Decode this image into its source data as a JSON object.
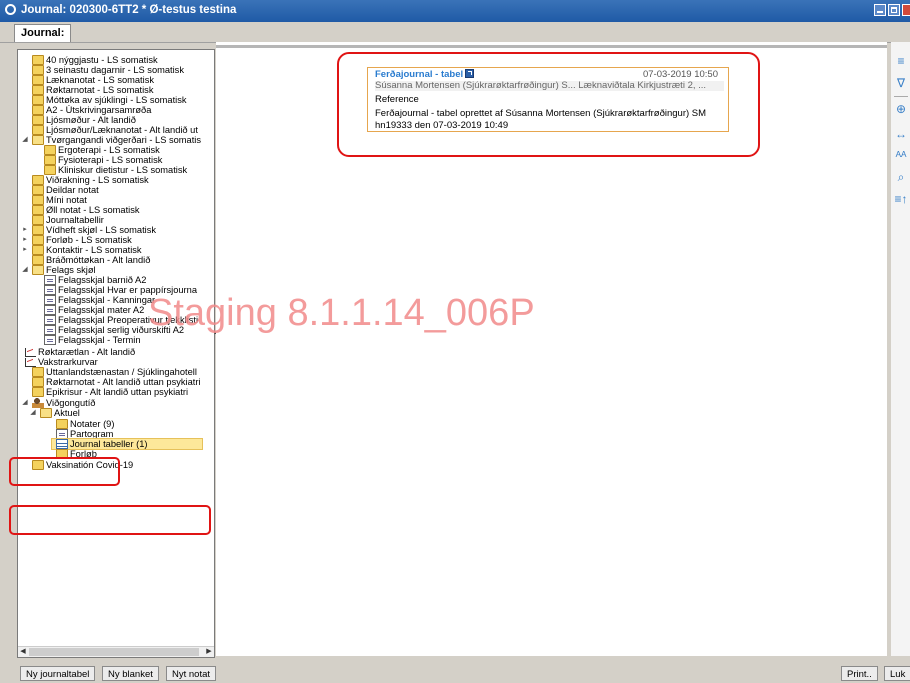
{
  "window": {
    "title": "Journal: 020300-6TT2 * Ø-testus testina"
  },
  "tab": {
    "label": "Journal:"
  },
  "tree": [
    {
      "label": "40 nýggjastu - LS somatisk",
      "icon": "folder-icon"
    },
    {
      "label": "3 seinastu dagarnir - LS somatisk",
      "icon": "folder-icon"
    },
    {
      "label": "Læknanotat - LS somatisk",
      "icon": "folder-icon"
    },
    {
      "label": "Røktarnotat - LS somatisk",
      "icon": "folder-icon"
    },
    {
      "label": "Móttøka av sjúklingi - LS somatisk",
      "icon": "folder-icon"
    },
    {
      "label": "A2 - Útskrivingarsamrøða",
      "icon": "folder-icon"
    },
    {
      "label": "Ljósmøður - Alt landið",
      "icon": "folder-icon"
    },
    {
      "label": "Ljósmøður/Læknanotat - Alt landið ut",
      "icon": "folder-icon"
    },
    {
      "label": "Tvørgangandi viðgerðari - LS somatis",
      "icon": "folder-open-icon",
      "expander": "◢"
    },
    {
      "label": "Ergoterapi - LS somatisk",
      "icon": "folder-icon"
    },
    {
      "label": "Fysioterapi - LS somatisk",
      "icon": "folder-icon"
    },
    {
      "label": "Kliniskur dietistur - LS somatisk",
      "icon": "folder-icon"
    },
    {
      "label": "Viðrakning - LS somatisk",
      "icon": "folder-icon"
    },
    {
      "label": "Deildar notat",
      "icon": "folder-icon"
    },
    {
      "label": "Míni notat",
      "icon": "folder-icon"
    },
    {
      "label": "Øll notat - LS somatisk",
      "icon": "folder-icon"
    },
    {
      "label": "Journaltabellir",
      "icon": "folder-icon"
    },
    {
      "label": "Vídheft skjøl - LS somatisk",
      "icon": "folder-icon",
      "expander": "▸"
    },
    {
      "label": "Forløb - LS somatisk",
      "icon": "folder-icon",
      "expander": "▸"
    },
    {
      "label": "Kontaktir - LS somatisk",
      "icon": "folder-icon",
      "expander": "▸"
    },
    {
      "label": "Bráðmóttøkan - Alt landið",
      "icon": "folder-icon"
    },
    {
      "label": "Felags skjøl",
      "icon": "folder-open-icon",
      "expander": "◢"
    },
    {
      "label": "Felagsskjal barnið A2",
      "icon": "document-icon"
    },
    {
      "label": "Felagsskjal Hvar er pappírsjourna",
      "icon": "document-icon"
    },
    {
      "label": "Felagsskjal - Kanningar",
      "icon": "document-icon"
    },
    {
      "label": "Felagsskjal mater A2",
      "icon": "document-icon"
    },
    {
      "label": "Felagsskjal Preoperativur tjekklisti",
      "icon": "document-icon"
    },
    {
      "label": "Felagsskjal serlig viðurskifti A2",
      "icon": "document-icon"
    },
    {
      "label": "Felagsskjal - Termin",
      "icon": "document-icon"
    },
    {
      "label": "Røktarætlan - Alt landið",
      "icon": "chart-icon"
    },
    {
      "label": "Vakstrarkurvar",
      "icon": "chart-icon"
    },
    {
      "label": "Uttanlandstænastan / Sjúklingahotell",
      "icon": "folder-icon"
    },
    {
      "label": "Røktarnotat - Alt landið uttan psykiatri",
      "icon": "folder-icon"
    },
    {
      "label": "Epikrisur - Alt landið uttan psykiatri",
      "icon": "folder-icon"
    },
    {
      "label": "Viðgongutíð",
      "icon": "person-icon",
      "expander": "◢"
    },
    {
      "label": "Aktuel",
      "icon": "folder-open-icon",
      "expander": "◢"
    },
    {
      "label": "Notater (9)",
      "icon": "folder-icon"
    },
    {
      "label": "Partogram",
      "icon": "document-icon"
    },
    {
      "label": "Journal tabeller (1)",
      "icon": "table-icon",
      "selected": true
    },
    {
      "label": "Forløb",
      "icon": "folder-icon"
    },
    {
      "label": "Vaksinatión Covid-19",
      "icon": "folder-icon"
    }
  ],
  "card": {
    "title": "Ferðajournal - tabel",
    "date": "07-03-2019 10:50",
    "meta": "Súsanna Mortensen (Sjúkrarøktarfrøðingur) S...   Læknaviðtala Kirkjustræti 2, ...",
    "line1": "Reference",
    "line2": "Ferðajournal - tabel    oprettet af Súsanna Mortensen (Sjúkrarøktarfrøðingur) SM",
    "line3": "hn19333 den 07-03-2019 10:49"
  },
  "watermark": "Staging 8.1.1.14_006P",
  "bottom": {
    "btn_new_table": "Ny journaltabel",
    "btn_new_blank": "Ny blanket",
    "btn_new_note": "Nyt notat",
    "btn_print": "Print..",
    "btn_close": "Luk"
  },
  "colors": {
    "titlebar": "#1f5aa6",
    "highlight": "#e01414",
    "selection": "#fde89a",
    "card_border": "#e6a64e"
  }
}
